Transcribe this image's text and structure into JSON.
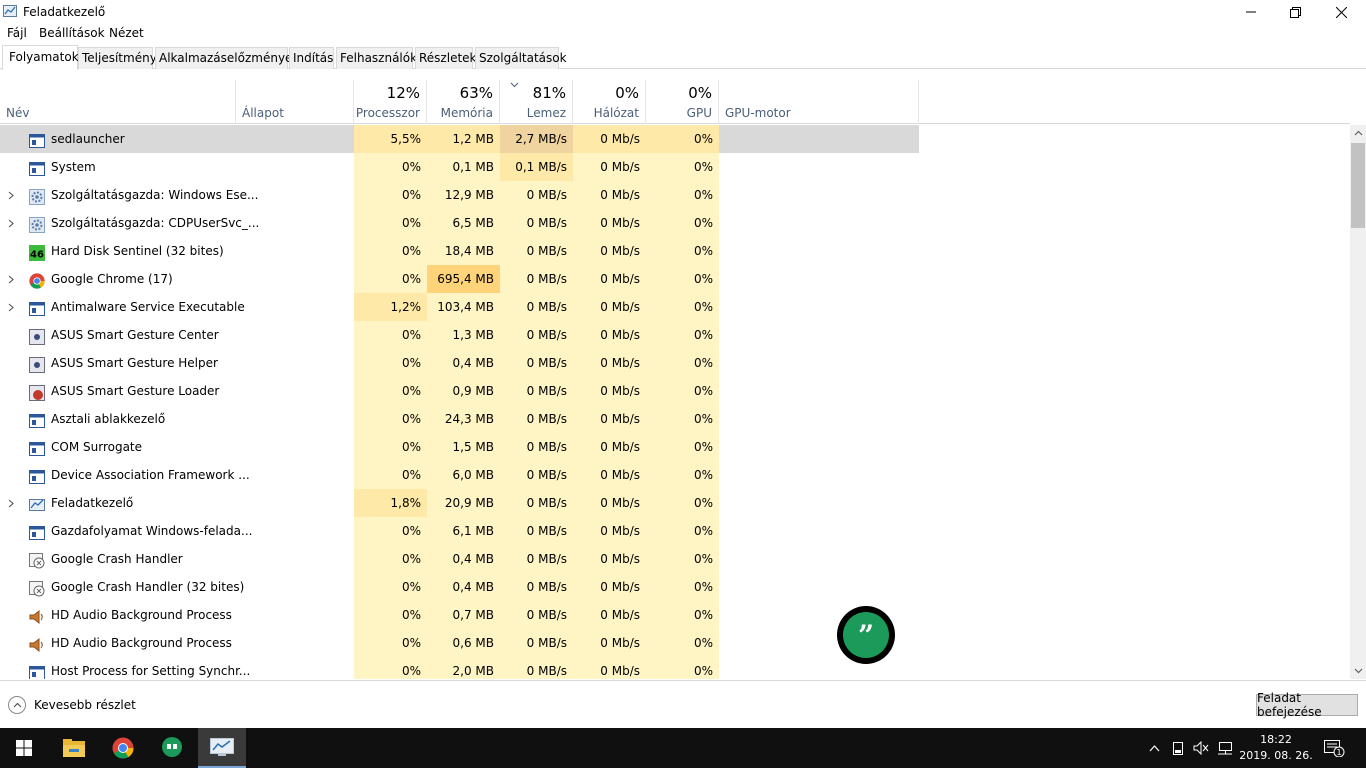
{
  "window": {
    "title": "Feladatkezelő"
  },
  "menu": {
    "file": "Fájl",
    "options": "Beállítások",
    "view": "Nézet"
  },
  "tabs": [
    {
      "label": "Folyamatok",
      "active": true
    },
    {
      "label": "Teljesítmény"
    },
    {
      "label": "Alkalmazáselőzmények"
    },
    {
      "label": "Indítás"
    },
    {
      "label": "Felhasználók"
    },
    {
      "label": "Részletek"
    },
    {
      "label": "Szolgáltatások"
    }
  ],
  "columns": {
    "name": "Név",
    "status": "Állapot",
    "cpu": {
      "pct": "12%",
      "label": "Processzor"
    },
    "memory": {
      "pct": "63%",
      "label": "Memória"
    },
    "disk": {
      "pct": "81%",
      "label": "Lemez"
    },
    "network": {
      "pct": "0%",
      "label": "Hálózat"
    },
    "gpu": {
      "pct": "0%",
      "label": "GPU"
    },
    "gpu_engine": "GPU-motor"
  },
  "processes": [
    {
      "name": "sedlauncher",
      "icon": "app-window-icon",
      "expandable": false,
      "cpu": "5,5%",
      "mem": "1,2 MB",
      "disk": "2,7 MB/s",
      "net": "0 Mb/s",
      "gpu": "0%"
    },
    {
      "name": "System",
      "icon": "app-window-icon",
      "expandable": false,
      "cpu": "0%",
      "mem": "0,1 MB",
      "disk": "0,1 MB/s",
      "net": "0 Mb/s",
      "gpu": "0%"
    },
    {
      "name": "Szolgáltatásgazda: Windows Ese...",
      "icon": "gear-icon",
      "expandable": true,
      "cpu": "0%",
      "mem": "12,9 MB",
      "disk": "0 MB/s",
      "net": "0 Mb/s",
      "gpu": "0%"
    },
    {
      "name": "Szolgáltatásgazda: CDPUserSvc_...",
      "icon": "gear-icon",
      "expandable": true,
      "cpu": "0%",
      "mem": "6,5 MB",
      "disk": "0 MB/s",
      "net": "0 Mb/s",
      "gpu": "0%"
    },
    {
      "name": "Hard Disk Sentinel (32 bites)",
      "icon": "hard-disk-sentinel-icon",
      "icon_text": "46",
      "expandable": false,
      "cpu": "0%",
      "mem": "18,4 MB",
      "disk": "0 MB/s",
      "net": "0 Mb/s",
      "gpu": "0%"
    },
    {
      "name": "Google Chrome (17)",
      "icon": "chrome-icon",
      "expandable": true,
      "cpu": "0%",
      "mem": "695,4 MB",
      "disk": "0 MB/s",
      "net": "0 Mb/s",
      "gpu": "0%"
    },
    {
      "name": "Antimalware Service Executable",
      "icon": "app-window-icon",
      "expandable": true,
      "cpu": "1,2%",
      "mem": "103,4 MB",
      "disk": "0 MB/s",
      "net": "0 Mb/s",
      "gpu": "0%"
    },
    {
      "name": "ASUS Smart Gesture Center",
      "icon": "asus-gesture-icon",
      "expandable": false,
      "cpu": "0%",
      "mem": "1,3 MB",
      "disk": "0 MB/s",
      "net": "0 Mb/s",
      "gpu": "0%"
    },
    {
      "name": "ASUS Smart Gesture Helper",
      "icon": "asus-gesture-icon",
      "expandable": false,
      "cpu": "0%",
      "mem": "0,4 MB",
      "disk": "0 MB/s",
      "net": "0 Mb/s",
      "gpu": "0%"
    },
    {
      "name": "ASUS Smart Gesture Loader",
      "icon": "asus-loader-icon",
      "expandable": false,
      "cpu": "0%",
      "mem": "0,9 MB",
      "disk": "0 MB/s",
      "net": "0 Mb/s",
      "gpu": "0%"
    },
    {
      "name": "Asztali ablakkezelő",
      "icon": "app-window-icon",
      "expandable": false,
      "cpu": "0%",
      "mem": "24,3 MB",
      "disk": "0 MB/s",
      "net": "0 Mb/s",
      "gpu": "0%"
    },
    {
      "name": "COM Surrogate",
      "icon": "app-window-icon",
      "expandable": false,
      "cpu": "0%",
      "mem": "1,5 MB",
      "disk": "0 MB/s",
      "net": "0 Mb/s",
      "gpu": "0%"
    },
    {
      "name": "Device Association Framework ...",
      "icon": "app-window-icon",
      "expandable": false,
      "cpu": "0%",
      "mem": "6,0 MB",
      "disk": "0 MB/s",
      "net": "0 Mb/s",
      "gpu": "0%"
    },
    {
      "name": "Feladatkezelő",
      "icon": "task-manager-icon",
      "expandable": true,
      "cpu": "1,8%",
      "mem": "20,9 MB",
      "disk": "0 MB/s",
      "net": "0 Mb/s",
      "gpu": "0%"
    },
    {
      "name": "Gazdafolyamat Windows-felada...",
      "icon": "app-window-icon",
      "expandable": false,
      "cpu": "0%",
      "mem": "6,1 MB",
      "disk": "0 MB/s",
      "net": "0 Mb/s",
      "gpu": "0%"
    },
    {
      "name": "Google Crash Handler",
      "icon": "crash-handler-icon",
      "expandable": false,
      "cpu": "0%",
      "mem": "0,4 MB",
      "disk": "0 MB/s",
      "net": "0 Mb/s",
      "gpu": "0%"
    },
    {
      "name": "Google Crash Handler (32 bites)",
      "icon": "crash-handler-icon",
      "expandable": false,
      "cpu": "0%",
      "mem": "0,4 MB",
      "disk": "0 MB/s",
      "net": "0 Mb/s",
      "gpu": "0%"
    },
    {
      "name": "HD Audio Background Process",
      "icon": "speaker-icon",
      "expandable": false,
      "cpu": "0%",
      "mem": "0,7 MB",
      "disk": "0 MB/s",
      "net": "0 Mb/s",
      "gpu": "0%"
    },
    {
      "name": "HD Audio Background Process",
      "icon": "speaker-icon",
      "expandable": false,
      "cpu": "0%",
      "mem": "0,6 MB",
      "disk": "0 MB/s",
      "net": "0 Mb/s",
      "gpu": "0%"
    },
    {
      "name": "Host Process for Setting Synchr...",
      "icon": "app-window-icon",
      "expandable": false,
      "cpu": "0%",
      "mem": "2,0 MB",
      "disk": "0 MB/s",
      "net": "0 Mb/s",
      "gpu": "0%"
    }
  ],
  "footer": {
    "fewer_details": "Kevesebb részlet",
    "end_task": "Feladat befejezése"
  },
  "taskbar": {
    "time": "18:22",
    "date": "2019. 08. 26.",
    "notification_count": "1"
  },
  "colors": {
    "accent": "#1b9a59",
    "heat_low": "#fff4c4",
    "heat_mid": "#ffe9a8",
    "heat_high": "#ffd37a"
  }
}
